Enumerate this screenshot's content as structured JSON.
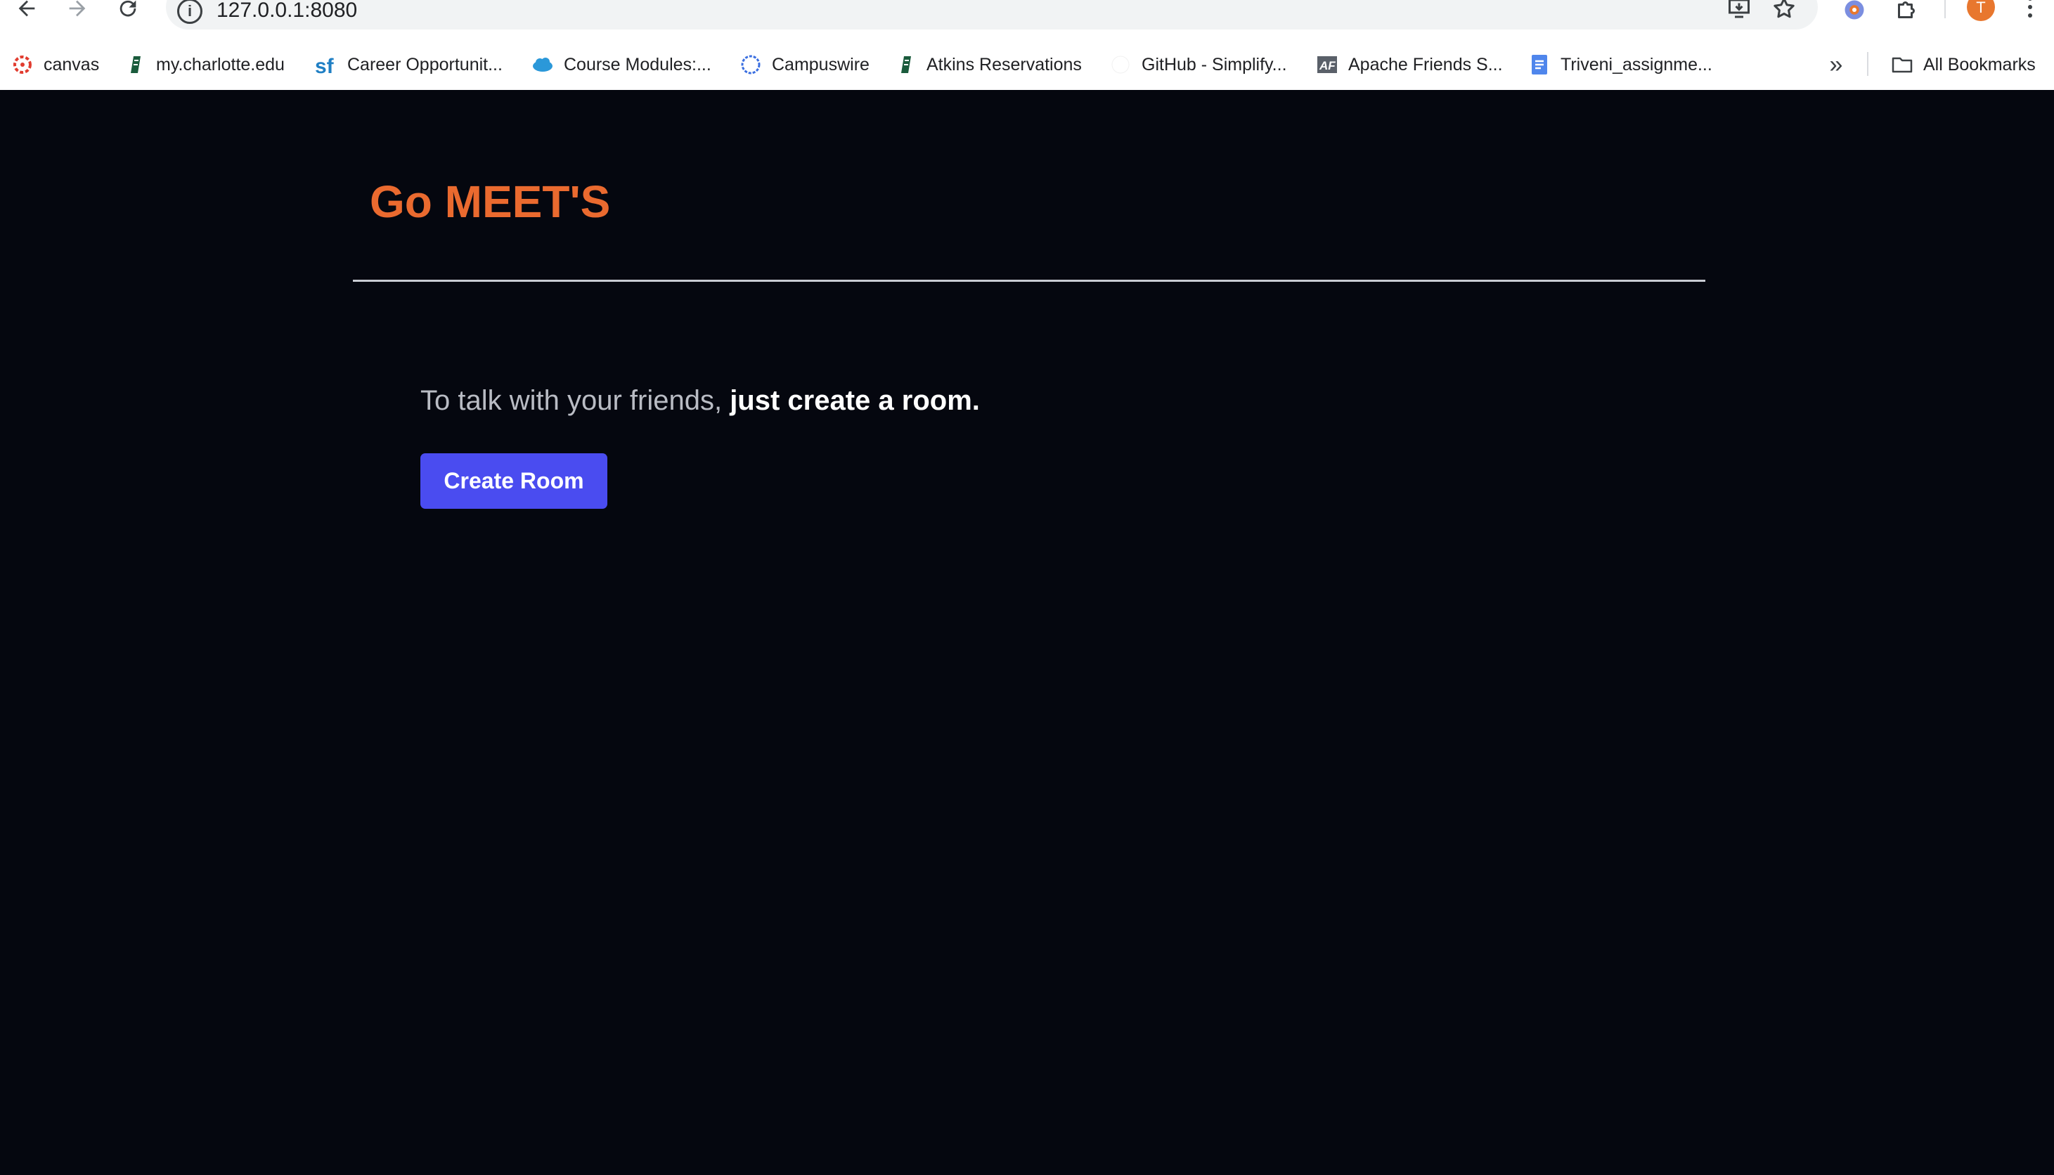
{
  "browser": {
    "url": "127.0.0.1:8080",
    "avatar_letter": "T",
    "bookmarks": [
      {
        "label": "canvas",
        "icon": "canvas-icon"
      },
      {
        "label": "my.charlotte.edu",
        "icon": "charlotte-icon"
      },
      {
        "label": "Career Opportunit...",
        "icon": "successfactors-icon"
      },
      {
        "label": "Course Modules:...",
        "icon": "salesforce-cloud-icon"
      },
      {
        "label": "Campuswire",
        "icon": "campuswire-icon"
      },
      {
        "label": "Atkins Reservations",
        "icon": "charlotte-icon"
      },
      {
        "label": "GitHub - Simplify...",
        "icon": "github-icon"
      },
      {
        "label": "Apache Friends S...",
        "icon": "apache-friends-icon"
      },
      {
        "label": "Triveni_assignme...",
        "icon": "google-docs-icon"
      }
    ],
    "all_bookmarks_label": "All Bookmarks"
  },
  "page": {
    "brand": "Go MEET'S",
    "tagline_prefix": "To talk with your friends, ",
    "tagline_emphasis": "just create a room.",
    "create_button_label": "Create Room"
  },
  "colors": {
    "background": "#05070f",
    "brand": "#ea6a2f",
    "button": "#4a4cf0"
  }
}
